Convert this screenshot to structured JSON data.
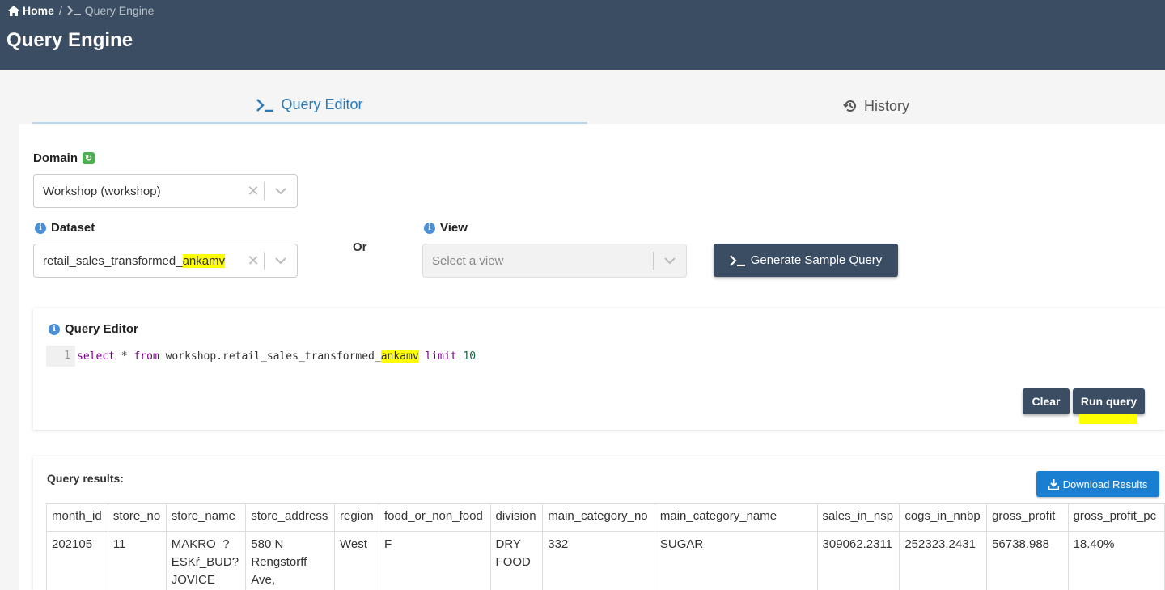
{
  "breadcrumb": {
    "home": "Home",
    "separator": "/",
    "current": "Query Engine"
  },
  "page_title": "Query Engine",
  "tabs": [
    {
      "label": "Query Editor",
      "icon": "terminal-icon",
      "active": true
    },
    {
      "label": "History",
      "icon": "history-icon",
      "active": false
    }
  ],
  "domain": {
    "label": "Domain",
    "value": "Workshop (workshop)"
  },
  "dataset": {
    "label": "Dataset",
    "value_prefix": "retail_sales_transformed_",
    "value_highlight": "ankamv"
  },
  "or_label": "Or",
  "view": {
    "label": "View",
    "placeholder": "Select a view"
  },
  "generate_button": "Generate Sample Query",
  "editor": {
    "label": "Query Editor",
    "line_number": "1",
    "kw_select": "select",
    "star": " * ",
    "kw_from": "from",
    "table_prefix": " workshop.retail_sales_transformed_",
    "table_highlight": "ankamv",
    "kw_limit": " limit ",
    "limit_value": "10"
  },
  "clear_button": "Clear",
  "run_button": "Run query",
  "results": {
    "title": "Query results:",
    "download_button": "Download Results",
    "columns": [
      "month_id",
      "store_no",
      "store_name",
      "store_address",
      "region",
      "food_or_non_food",
      "division",
      "main_category_no",
      "main_category_name",
      "sales_in_nsp",
      "cogs_in_nnbp",
      "gross_profit",
      "gross_profit_pc"
    ],
    "rows": [
      [
        "202105",
        "11",
        "MAKRO_? ESKŕ_BUD? JOVICE",
        "580 N Rengstorff Ave,",
        "West",
        "F",
        "DRY FOOD",
        "332",
        "SUGAR",
        "309062.2311",
        "252323.2431",
        "56738.988",
        "18.40%"
      ]
    ]
  },
  "colors": {
    "header_bg": "#3a4d63",
    "accent": "#2a7ab8",
    "download_bg": "#1a7fd1",
    "highlight": "#ffff00"
  }
}
